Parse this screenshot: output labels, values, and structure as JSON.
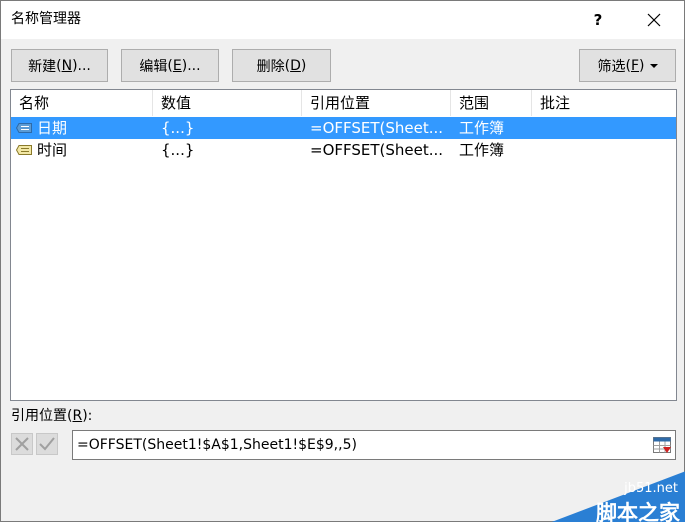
{
  "window": {
    "title": "名称管理器",
    "help_label": "?",
    "close_label": "✕"
  },
  "toolbar": {
    "new_label": "新建",
    "new_key": "N",
    "edit_label": "编辑",
    "edit_key": "E",
    "delete_label": "删除",
    "delete_key": "D",
    "filter_label": "筛选",
    "filter_key": "F",
    "ellipsis": "..."
  },
  "table": {
    "columns": [
      "名称",
      "数值",
      "引用位置",
      "范围",
      "批注"
    ],
    "rows": [
      {
        "name": "日期",
        "value": "{...}",
        "refers_to": "=OFFSET(Sheet...",
        "scope": "工作簿",
        "comment": "",
        "selected": true
      },
      {
        "name": "时间",
        "value": "{...}",
        "refers_to": "=OFFSET(Sheet...",
        "scope": "工作簿",
        "comment": "",
        "selected": false
      }
    ]
  },
  "refers": {
    "label": "引用位置",
    "key": "R",
    "value": "=OFFSET(Sheet1!$A$1,Sheet1!$E$9,,5)"
  },
  "watermark": {
    "site": "jb51.net",
    "name": "脚本之家"
  },
  "colors": {
    "selection": "#3399ff",
    "watermark_blue": "#2a7fd4"
  }
}
